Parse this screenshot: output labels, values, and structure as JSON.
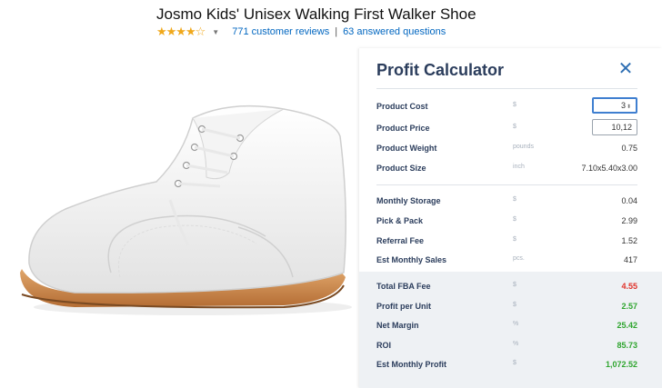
{
  "product": {
    "title": "Josmo Kids' Unisex Walking First Walker Shoe",
    "stars": "★★★★☆",
    "reviews_link": "771 customer reviews",
    "separator": "|",
    "questions_link": "63 answered questions"
  },
  "calculator": {
    "title": "Profit Calculator",
    "close_label": "✕",
    "inputs": [
      {
        "label": "Product Cost",
        "unit": "$",
        "value": "3"
      },
      {
        "label": "Product Price",
        "unit": "$",
        "value": "10,12"
      }
    ],
    "specs": [
      {
        "label": "Product Weight",
        "unit": "pounds",
        "value": "0.75"
      },
      {
        "label": "Product Size",
        "unit": "inch",
        "value": "7.10x5.40x3.00"
      }
    ],
    "fees": [
      {
        "label": "Monthly Storage",
        "unit": "$",
        "value": "0.04"
      },
      {
        "label": "Pick & Pack",
        "unit": "$",
        "value": "2.99"
      },
      {
        "label": "Referral Fee",
        "unit": "$",
        "value": "1.52"
      },
      {
        "label": "Est Monthly Sales",
        "unit": "pcs.",
        "value": "417"
      }
    ],
    "summary": [
      {
        "label": "Total FBA Fee",
        "unit": "$",
        "value": "4.55"
      },
      {
        "label": "Profit per Unit",
        "unit": "$",
        "value": "2.57"
      },
      {
        "label": "Net Margin",
        "unit": "%",
        "value": "25.42"
      },
      {
        "label": "ROI",
        "unit": "%",
        "value": "85.73"
      },
      {
        "label": "Est Monthly Profit",
        "unit": "$",
        "value": "1,072.52"
      }
    ],
    "colors": {
      "accent": "#2b3d5c",
      "close": "#2f6fb3",
      "negative": "#e0332b",
      "positive": "#2fa52f"
    }
  }
}
